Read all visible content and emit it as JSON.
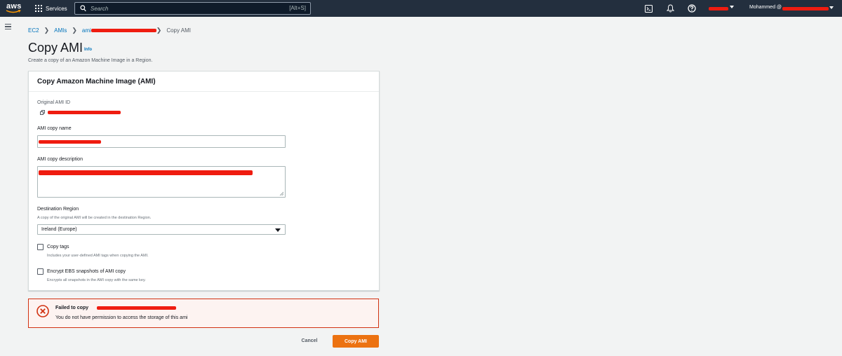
{
  "topnav": {
    "logo_text": "aws",
    "services_label": "Services",
    "search_placeholder": "Search",
    "search_shortcut": "[Alt+S]",
    "icons": [
      "cloudshell-icon",
      "bell-icon",
      "help-icon"
    ],
    "user_label": "Mohammed @"
  },
  "breadcrumb": {
    "items": [
      "EC2",
      "AMIs",
      "ami"
    ],
    "current": "Copy AMI"
  },
  "page": {
    "title": "Copy AMI",
    "info": "Info",
    "description": "Create a copy of an Amazon Machine Image in a Region."
  },
  "panel": {
    "title": "Copy Amazon Machine Image (AMI)",
    "original_ami_label": "Original AMI ID",
    "copy_name_label": "AMI copy name",
    "copy_description_label": "AMI copy description",
    "destination_label": "Destination Region",
    "destination_hint": "A copy of the original AMI will be created in the destination Region.",
    "destination_value": "Ireland (Europe)",
    "copy_tags_label": "Copy tags",
    "copy_tags_hint": "Includes your user-defined AMI tags when copying the AMI.",
    "copy_tags_checked": false,
    "encrypt_label": "Encrypt EBS snapshots of AMI copy",
    "encrypt_hint": "Encrypts all snapshots in the AMI copy with the same key.",
    "encrypt_checked": false
  },
  "alert": {
    "title": "Failed to copy",
    "message": "You do not have permission to access the storage of this ami",
    "color": "#d13212"
  },
  "actions": {
    "cancel": "Cancel",
    "submit": "Copy AMI"
  },
  "colors": {
    "nav_bg": "#232f3e",
    "link": "#0073bb",
    "primary": "#ec7211",
    "redaction": "#ef1c10"
  }
}
